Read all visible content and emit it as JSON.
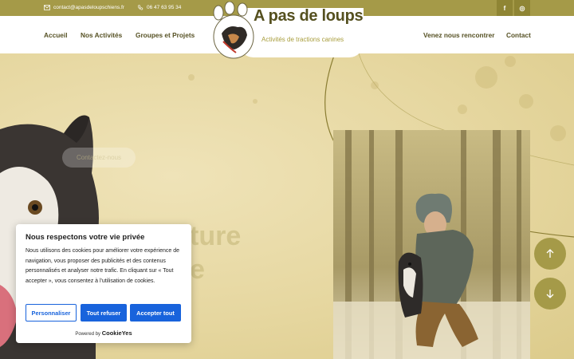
{
  "topbar": {
    "email": "contact@apasdeloupschiens.fr",
    "phone": "06 47 63 95 34",
    "social": [
      {
        "icon": "facebook-icon",
        "glyph": "f"
      },
      {
        "icon": "instagram-icon",
        "glyph": "◎"
      }
    ]
  },
  "logo": {
    "title": "A pas de loups",
    "subtitle": "Activités de tractions canines"
  },
  "nav": {
    "home": "Accueil",
    "activities": "Nos Activités",
    "groups": "Groupes et Projets",
    "visit": "Venez nous rencontrer",
    "contact": "Contact"
  },
  "hero": {
    "cta": "Contactez-nous",
    "word1": "ture",
    "word2": "e"
  },
  "cookie": {
    "title": "Nous respectons votre vie privée",
    "body": "Nous utilisons des cookies pour améliorer votre expérience de navigation, vous proposer des publicités et des contenus personnalisés et analyser notre trafic. En cliquant sur « Tout accepter », vous consentez à l'utilisation de cookies.",
    "customize": "Personnaliser",
    "reject": "Tout refuser",
    "accept": "Accepter tout",
    "powered_by": "Powered by",
    "brand": "CookieYes"
  },
  "colors": {
    "olive": "#a59a48",
    "cookie_blue": "#1863dc"
  }
}
